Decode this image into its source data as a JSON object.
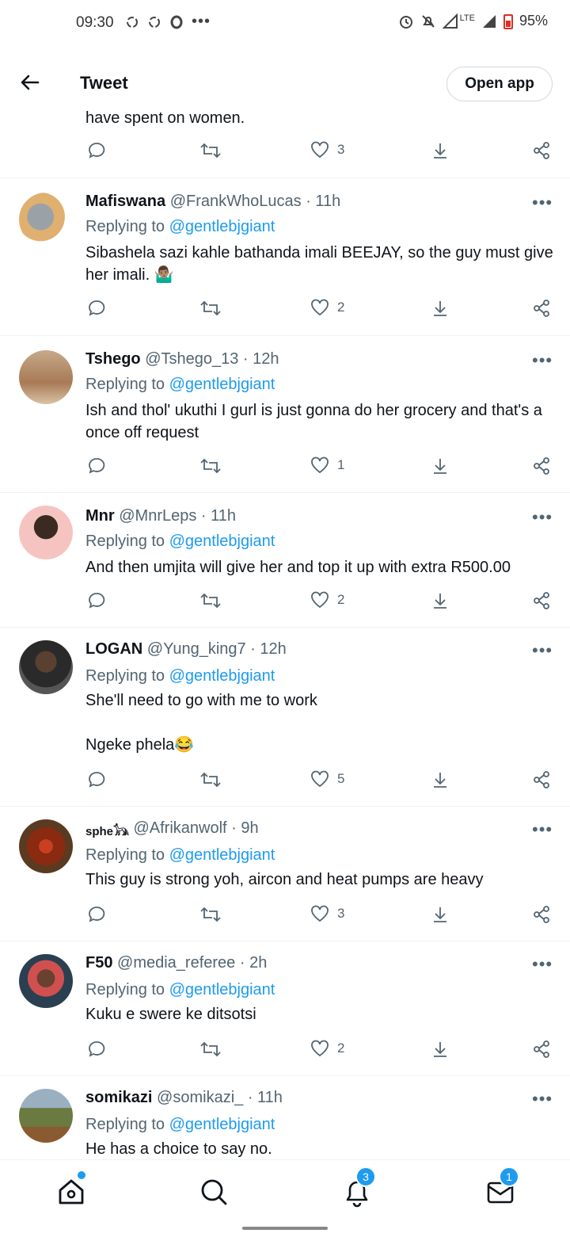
{
  "status": {
    "time": "09:30",
    "battery": "95%",
    "network": "LTE"
  },
  "header": {
    "title": "Tweet",
    "open_app": "Open app"
  },
  "prev": {
    "text": "have spent on women.",
    "likes": "3"
  },
  "replying_prefix": "Replying to",
  "replying_handle": "@gentlebjgiant",
  "tweets": [
    {
      "name": "Mafiswana",
      "meta": "@FrankWhoLucas · 11h",
      "text": "Sibashela sazi kahle bathanda imali BEEJAY, so the guy must give her imali. 🤷🏽‍♂️",
      "likes": "2"
    },
    {
      "name": "Tshego",
      "meta": "@Tshego_13 · 12h",
      "text": "Ish and thol' ukuthi I gurl is just gonna do her grocery and that's a once off request",
      "likes": "1"
    },
    {
      "name": "Mnr",
      "meta": "@MnrLeps · 11h",
      "text": "And then umjita will give her and top it up with extra R500.00",
      "likes": "2"
    },
    {
      "name": "LOGAN",
      "meta": "@Yung_king7 · 12h",
      "text": "She'll need to go with me to work\n\nNgeke phela😂",
      "likes": "5"
    },
    {
      "name": "sphe𓃥",
      "meta": "@Afrikanwolf · 9h",
      "text": "This guy is strong yoh, aircon and heat pumps are heavy",
      "likes": "3"
    },
    {
      "name": "F50",
      "meta": "@media_referee · 2h",
      "text": "Kuku e swere ke ditsotsi",
      "likes": "2"
    },
    {
      "name": "somikazi",
      "meta": "@somikazi_ · 11h",
      "text": "He has a choice to say no.",
      "likes": ""
    }
  ],
  "nav": {
    "notifications_badge": "3",
    "messages_badge": "1"
  },
  "colors": {
    "accent": "#1d9bf0",
    "muted": "#536471",
    "text": "#0f1419"
  }
}
